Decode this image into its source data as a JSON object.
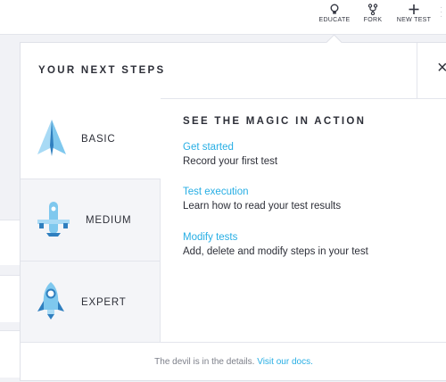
{
  "topbar": {
    "educate_label": "EDUCATE",
    "fork_label": "FORK",
    "new_test_label": "NEW TEST"
  },
  "panel": {
    "title": "YOUR NEXT STEPS",
    "close_glyph": "×"
  },
  "levels": [
    {
      "label": "BASIC",
      "icon": "paper-plane-icon",
      "active": true
    },
    {
      "label": "MEDIUM",
      "icon": "airplane-icon",
      "active": false
    },
    {
      "label": "EXPERT",
      "icon": "rocket-icon",
      "active": false
    }
  ],
  "content": {
    "title": "SEE THE MAGIC IN ACTION",
    "steps": [
      {
        "link": "Get started",
        "desc": "Record your first test"
      },
      {
        "link": "Test execution",
        "desc": "Learn how to read your test results"
      },
      {
        "link": "Modify tests",
        "desc": "Add, delete and modify steps in your test"
      }
    ]
  },
  "footer": {
    "text": "The devil is in the details.",
    "link": "Visit our docs."
  },
  "colors": {
    "accent": "#27aee4",
    "icon_light": "#7fc8ee",
    "icon_dark": "#2f7fbf",
    "background": "#f1f2f6"
  }
}
